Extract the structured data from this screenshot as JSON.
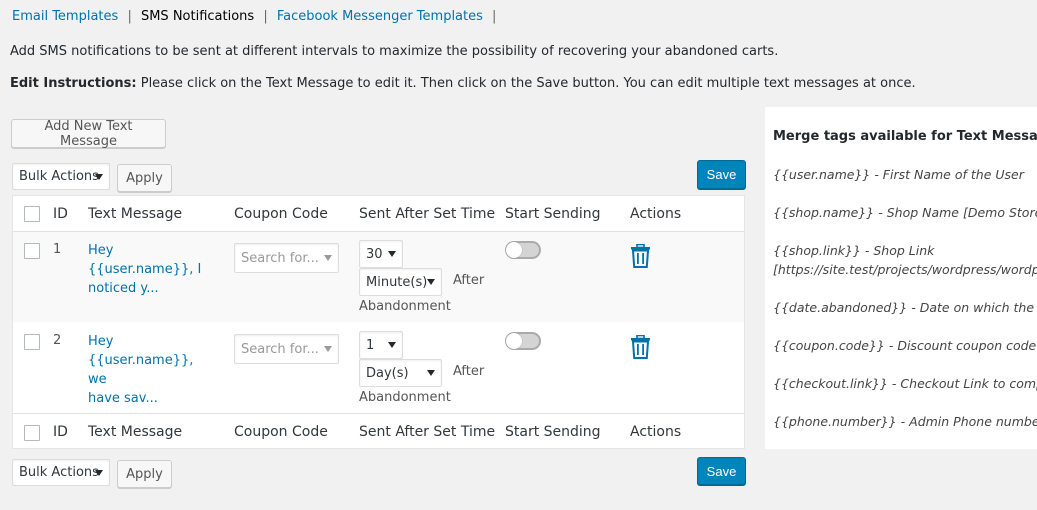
{
  "tabs": [
    {
      "label": "Email Templates",
      "current": false
    },
    {
      "label": "SMS Notifications",
      "current": true
    },
    {
      "label": "Facebook Messenger Templates",
      "current": false
    }
  ],
  "tab_separator": "|",
  "description": "Add SMS notifications to be sent at different intervals to maximize the possibility of recovering your abandoned carts.",
  "instructions": {
    "label": "Edit Instructions:",
    "text": "Please click on the Text Message to edit it. Then click on the Save button. You can edit multiple text messages at once."
  },
  "add_new_label": "Add New Text Message",
  "bulk": {
    "select_value": "Bulk Actions",
    "apply_label": "Apply",
    "save_label": "Save"
  },
  "columns": [
    "ID",
    "Text Message",
    "Coupon Code",
    "Sent After Set Time",
    "Start Sending",
    "Actions"
  ],
  "rows": [
    {
      "id": "1",
      "message_line1": "Hey {{user.name}}, I",
      "message_line2": "noticed y...",
      "coupon_placeholder": "Search for...",
      "time_value": "30",
      "time_unit": "Minute(s)",
      "after_label": "After",
      "abandonment_label": "Abandonment",
      "start_sending": false
    },
    {
      "id": "2",
      "message_line1": "Hey {{user.name}}, we",
      "message_line2": "have sav...",
      "coupon_placeholder": "Search for...",
      "time_value": "1",
      "time_unit": "Day(s)",
      "after_label": "After",
      "abandonment_label": "Abandonment",
      "start_sending": false
    }
  ],
  "merge_tags": {
    "title": "Merge tags available for Text Messages:",
    "items": [
      "{{user.name}} - First Name of the User",
      "{{shop.name}} - Shop Name [Demo Store]",
      "{{shop.link}} - Shop Link",
      "[https://site.test/projects/wordpress/wordpress_demo]",
      "{{date.abandoned}} - Date on which the Cart was abandoned",
      "{{coupon.code}} - Discount coupon code",
      "{{checkout.link}} - Checkout Link to complete the order",
      "{{phone.number}} - Admin Phone number"
    ]
  },
  "icons": {
    "delete": "trash-icon",
    "dropdown": "chevron-down-icon"
  },
  "colors": {
    "link": "#0073aa",
    "primary_button": "#0085ba",
    "delete_icon": "#0073aa"
  }
}
